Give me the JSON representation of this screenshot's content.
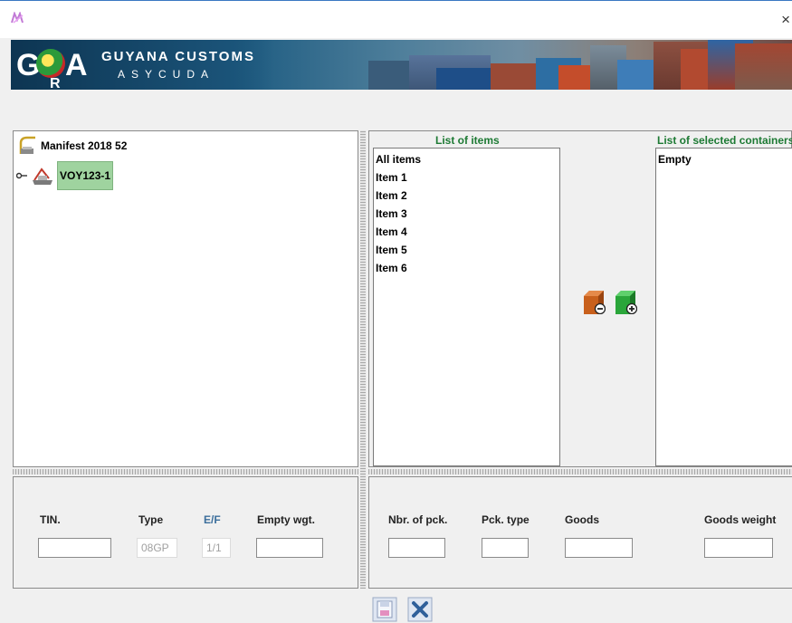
{
  "window": {
    "close_glyph": "×",
    "app_icon": "app-logo-icon"
  },
  "banner": {
    "brand_title": "GUYANA CUSTOMS",
    "brand_subtitle": "ASYCUDA",
    "logo_letters": {
      "g": "G",
      "a": "A",
      "r": "R"
    },
    "colors": {
      "sea": "#1b5a80",
      "sky": "#0d3552"
    }
  },
  "tree": {
    "root": {
      "label": "Manifest 2018 52",
      "icon": "manifest-icon"
    },
    "child": {
      "label": "VOY123-1",
      "icon": "voyage-icon",
      "expander": "o-"
    }
  },
  "items_list": {
    "title": "List of items",
    "entries": [
      "All items",
      "Item 1",
      "Item 2",
      "Item 3",
      "Item 4",
      "Item 5",
      "Item 6"
    ]
  },
  "selected_list": {
    "title": "List of selected containers",
    "entries": [
      "Empty"
    ]
  },
  "transfer": {
    "remove_icon": "remove-container-icon",
    "add_icon": "add-container-icon",
    "colors": {
      "remove": "#c8601c",
      "add": "#2aa63a"
    }
  },
  "container_form": {
    "tin_label": "TIN.",
    "tin_value": "",
    "type_label": "Type",
    "type_value": "08GP",
    "ef_label": "E/F",
    "ef_value": "1/1",
    "empty_wgt_label": "Empty wgt.",
    "empty_wgt_value": ""
  },
  "goods_form": {
    "nbr_pck_label": "Nbr. of pck.",
    "nbr_pck_value": "",
    "pck_type_label": "Pck. type",
    "pck_type_value": "",
    "goods_label": "Goods",
    "goods_value": "",
    "goods_weight_label": "Goods weight",
    "goods_weight_value": ""
  },
  "toolbar": {
    "save_icon": "save-icon",
    "cancel_icon": "cancel-icon",
    "accent": "#3a78c2"
  }
}
